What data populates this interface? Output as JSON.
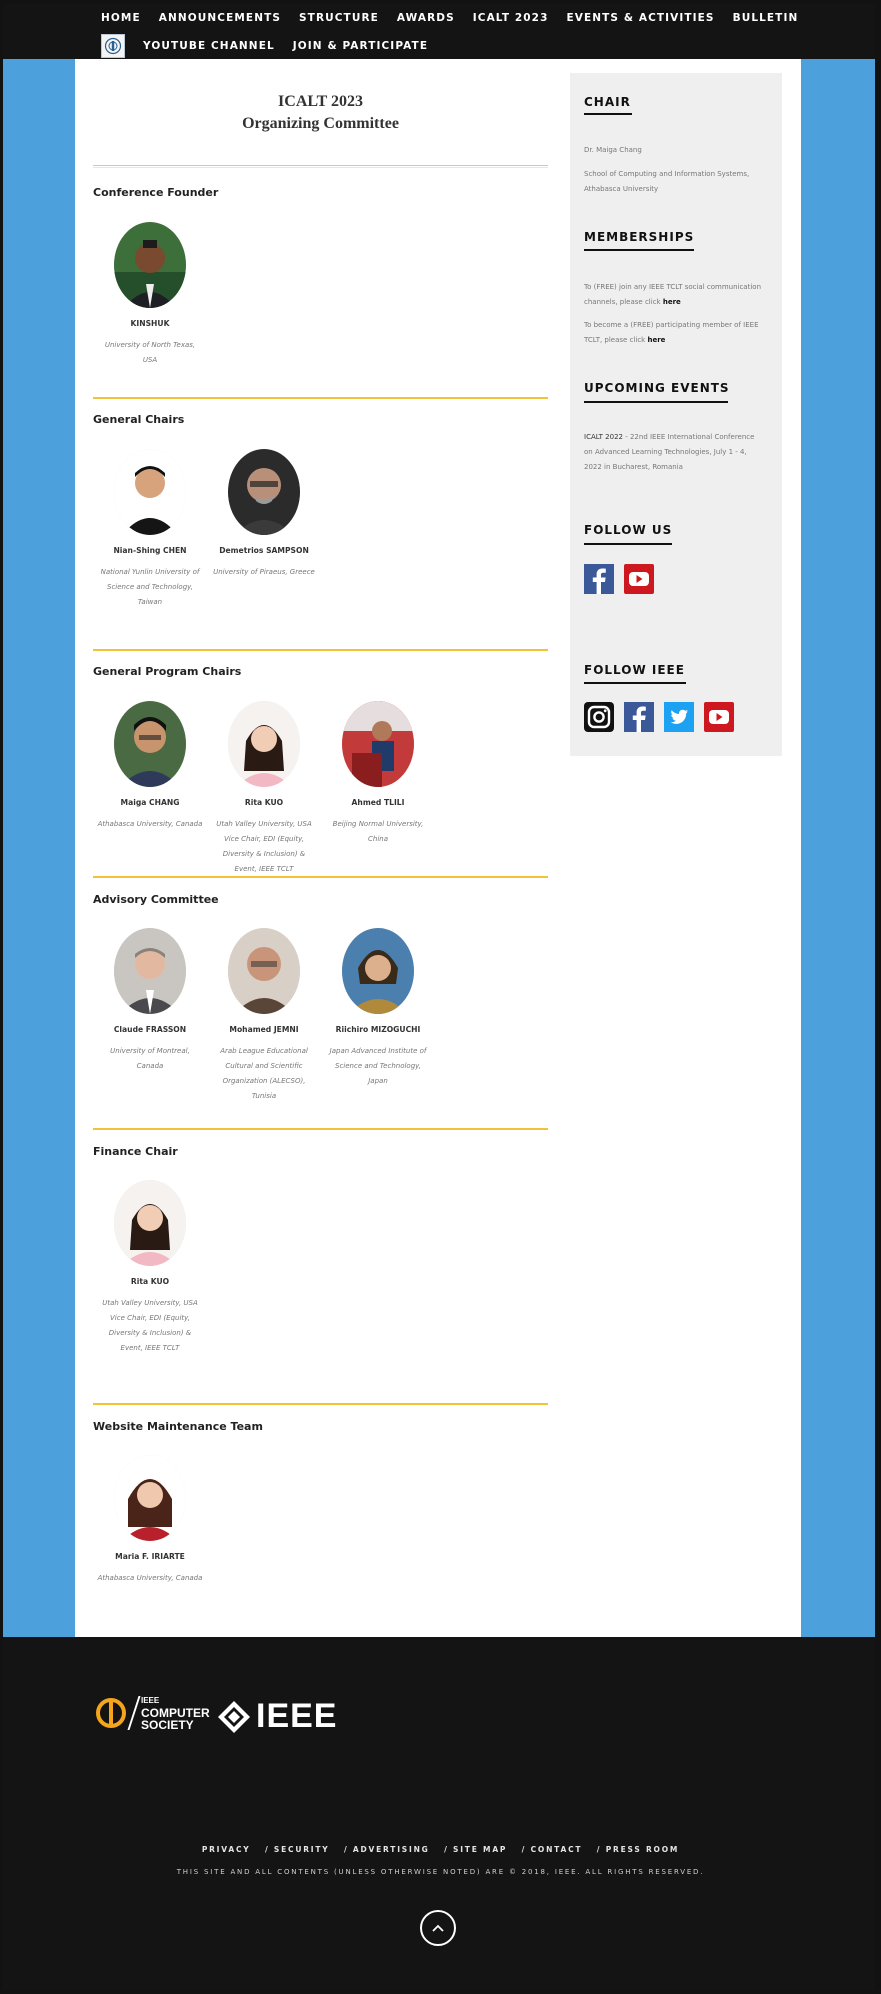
{
  "nav": {
    "row1": [
      "HOME",
      "ANNOUNCEMENTS",
      "STRUCTURE",
      "AWARDS",
      "ICALT 2023",
      "EVENTS & ACTIVITIES",
      "BULLETIN"
    ],
    "row2": [
      "YOUTUBE CHANNEL",
      "JOIN & PARTICIPATE"
    ]
  },
  "page": {
    "title_line1": "ICALT 2023",
    "title_line2": "Organizing Committee"
  },
  "sections": {
    "founder": {
      "title": "Conference Founder",
      "people": [
        {
          "name": "KINSHUK",
          "affiliation": "University of North Texas, USA"
        }
      ]
    },
    "general": {
      "title": "General Chairs",
      "people": [
        {
          "name": "Nian-Shing CHEN",
          "affiliation": "National Yunlin University of Science and Technology, Taiwan"
        },
        {
          "name": "Demetrios SAMPSON",
          "affiliation": "University of Piraeus, Greece"
        }
      ]
    },
    "program": {
      "title": "General Program Chairs",
      "people": [
        {
          "name": "Maiga CHANG",
          "affiliation": "Athabasca University, Canada"
        },
        {
          "name": "Rita KUO",
          "affiliation": "Utah Valley University, USA",
          "extra": "Vice Chair, EDI (Equity, Diversity & Inclusion) & Event, IEEE TCLT"
        },
        {
          "name": "Ahmed TLILI",
          "affiliation": "Beijing Normal University, China"
        }
      ]
    },
    "advisory": {
      "title": "Advisory Committee",
      "people": [
        {
          "name": "Claude FRASSON",
          "affiliation": "University of Montreal, Canada"
        },
        {
          "name": "Mohamed JEMNI",
          "affiliation": "Arab League Educational Cultural and Scientific Organization (ALECSO), Tunisia"
        },
        {
          "name": "Riichiro MIZOGUCHI",
          "affiliation": "Japan Advanced Institute of Science and Technology, Japan"
        }
      ]
    },
    "finance": {
      "title": "Finance Chair",
      "people": [
        {
          "name": "Rita KUO",
          "affiliation": "Utah Valley University, USA",
          "extra": "Vice Chair, EDI (Equity, Diversity & Inclusion) & Event, IEEE TCLT"
        }
      ]
    },
    "website": {
      "title": "Website Maintenance Team",
      "people": [
        {
          "name": "Maria F. IRIARTE",
          "affiliation": "Athabasca University, Canada"
        }
      ]
    }
  },
  "sidebar": {
    "chair_heading": "CHAIR",
    "chair_name": "Dr. Maiga Chang",
    "chair_affiliation": "School of Computing and Information Systems, Athabasca University",
    "memberships_heading": "MEMBERSHIPS",
    "membership_text1": "To (FREE) join any IEEE TCLT social communication channels, please click",
    "membership_link1": "here",
    "membership_text2": "To become a (FREE) participating member of IEEE TCLT, please click",
    "membership_link2": "here",
    "events_heading": "UPCOMING EVENTS",
    "event_strong": "ICALT 2022",
    "event_text": " - 22nd IEEE International Conference on Advanced Learning Technologies, July 1 - 4, 2022 in Bucharest, Romania",
    "follow_us_heading": "FOLLOW US",
    "follow_ieee_heading": "FOLLOW IEEE"
  },
  "footer": {
    "brand_cs_line1": "IEEE",
    "brand_cs_line2": "COMPUTER",
    "brand_cs_line3": "SOCIETY",
    "brand_ieee": "IEEE",
    "links": [
      "PRIVACY",
      "/ SECURITY",
      "/ ADVERTISING",
      "/ SITE MAP",
      "/ CONTACT",
      "/ PRESS ROOM"
    ],
    "copyright": "THIS SITE AND ALL CONTENTS (UNLESS OTHERWISE NOTED) ARE © 2018, IEEE. ALL RIGHTS RESERVED."
  },
  "colors": {
    "accent_rule": "#f2c33a",
    "frame_blue": "#4ca1dd",
    "nav_bg": "#141414",
    "facebook": "#3b5998",
    "youtube": "#cc181e",
    "twitter": "#1da1f2"
  },
  "icons": [
    "facebook-icon",
    "youtube-icon",
    "instagram-icon",
    "twitter-icon",
    "scroll-top-icon"
  ]
}
